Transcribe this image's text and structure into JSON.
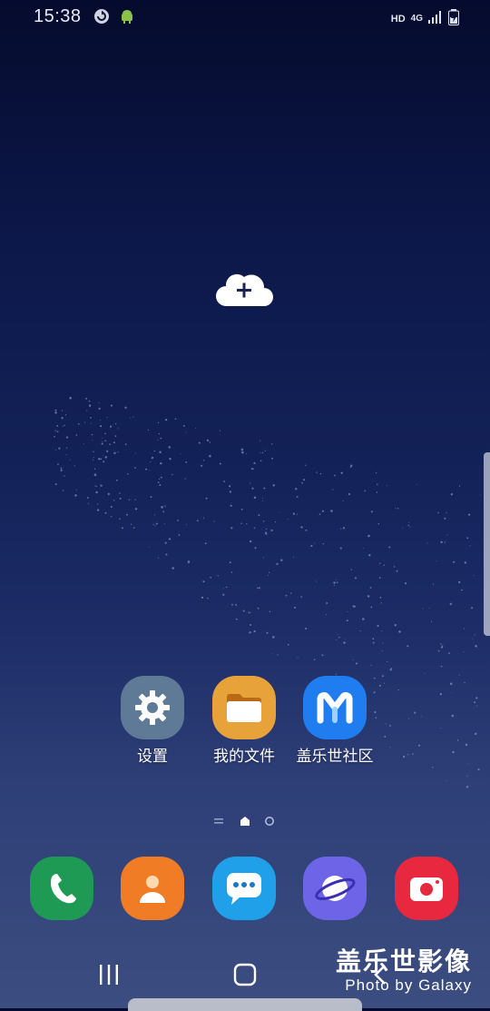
{
  "status_bar": {
    "time": "15:38",
    "left_icons": [
      "sync-icon",
      "android-debug-icon"
    ],
    "hd": "HD",
    "network": "4G",
    "right_icons": [
      "signal-icon",
      "battery-charging-icon"
    ]
  },
  "widget": {
    "icon": "cloud-add-icon"
  },
  "apps": [
    {
      "label": "设置",
      "icon": "gear-icon",
      "color": "#5f7a96"
    },
    {
      "label": "我的文件",
      "icon": "folder-icon",
      "color": "#e8a23a"
    },
    {
      "label": "盖乐世社区",
      "icon": "members-icon",
      "color": "#1f7df0"
    }
  ],
  "page_indicator": {
    "pages": 3,
    "current": 1
  },
  "dock": [
    {
      "name": "phone",
      "icon": "phone-icon",
      "color": "#1f9a55"
    },
    {
      "name": "contacts",
      "icon": "contact-icon",
      "color": "#f07c26"
    },
    {
      "name": "messages",
      "icon": "message-icon",
      "color": "#1fa0e8"
    },
    {
      "name": "internet",
      "icon": "planet-icon",
      "color": "#6d64e8"
    },
    {
      "name": "camera",
      "icon": "camera-icon",
      "color": "#e8283e"
    }
  ],
  "navigation": {
    "icons": [
      "recents-icon",
      "home-icon",
      "back-icon"
    ]
  },
  "watermark": {
    "title": "盖乐世影像",
    "subtitle": "Photo by Galaxy"
  }
}
